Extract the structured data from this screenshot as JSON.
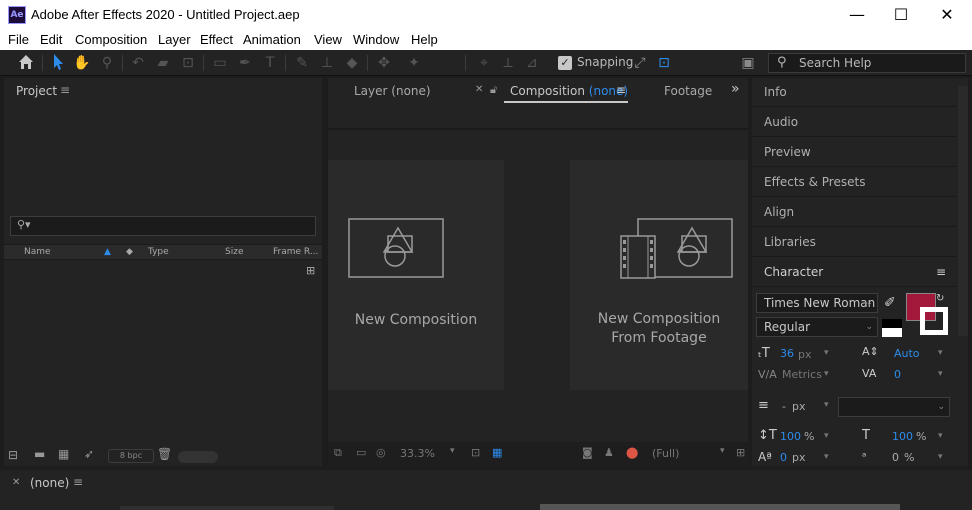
{
  "titlebar": {
    "app_icon": "Ae",
    "title": "Adobe After Effects 2020 - Untitled Project.aep",
    "minimize": "—",
    "maximize": "☐",
    "close": "✕"
  },
  "menu": [
    "File",
    "Edit",
    "Composition",
    "Layer",
    "Effect",
    "Animation",
    "View",
    "Window",
    "Help"
  ],
  "toolbar": {
    "snapping_label": "Snapping",
    "search_placeholder": "Search Help"
  },
  "project": {
    "title": "Project",
    "columns": [
      "Name",
      "Type",
      "Size",
      "Frame R..."
    ],
    "bpc": "8 bpc"
  },
  "composition": {
    "tab_layer": "Layer",
    "tab_layer_value": "(none)",
    "tab_comp": "Composition",
    "tab_comp_value": "(none)",
    "tab_footage": "Footage",
    "new_comp_label": "New Composition",
    "new_from_footage_line1": "New Composition",
    "new_from_footage_line2": "From Footage",
    "zoom": "33.3%",
    "resolution": "(Full)"
  },
  "right_panel": {
    "items": [
      "Info",
      "Audio",
      "Preview",
      "Effects & Presets",
      "Align",
      "Libraries"
    ],
    "character_title": "Character",
    "font_family": "Times New Roman",
    "font_style": "Regular",
    "font_size": "36",
    "font_size_unit": "px",
    "leading": "Auto",
    "kerning": "Metrics",
    "tracking": "0",
    "stroke_width": "-",
    "stroke_unit": "px",
    "vert_scale": "100",
    "horiz_scale": "100",
    "baseline": "0",
    "tsume": "0",
    "percent": "%",
    "fill_color": "#a3193b"
  },
  "timeline": {
    "tab_label": "(none)"
  }
}
